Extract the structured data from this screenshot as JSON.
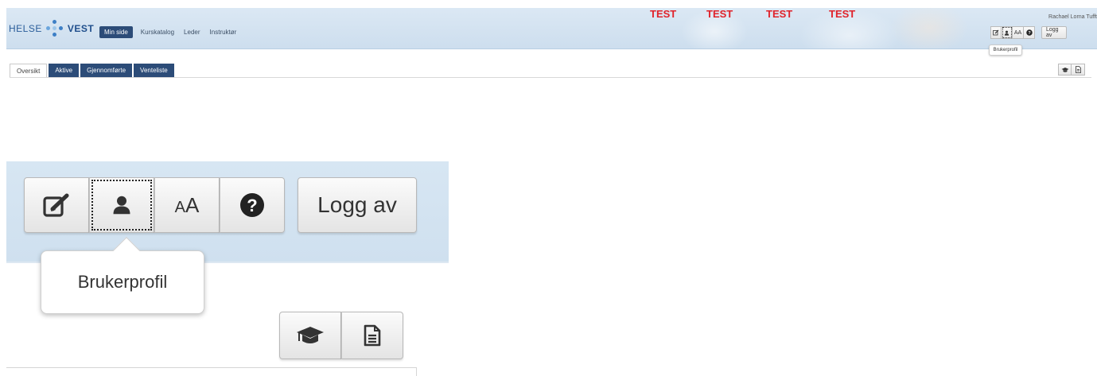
{
  "header": {
    "logo": {
      "left": "HELSE",
      "right": "VEST"
    },
    "nav": [
      {
        "label": "Min side",
        "active": true
      },
      {
        "label": "Kurskatalog",
        "active": false
      },
      {
        "label": "Leder",
        "active": false
      },
      {
        "label": "Instruktør",
        "active": false
      }
    ],
    "test_labels": [
      "TEST",
      "TEST",
      "TEST",
      "TEST"
    ],
    "user_name": "Rachael Lorna Tufft",
    "toolbar": {
      "edit_icon": "edit-icon",
      "profile_icon": "user-icon",
      "font_size_label": "AA",
      "help_icon": "question-icon",
      "logout_label": "Logg av"
    },
    "tooltip": "Brukerprofil"
  },
  "tabs": [
    {
      "label": "Oversikt",
      "active": true
    },
    {
      "label": "Aktive",
      "active": false
    },
    {
      "label": "Gjennomførte",
      "active": false
    },
    {
      "label": "Venteliste",
      "active": false
    }
  ],
  "right_toolbar": {
    "icons": [
      "graduation-cap-icon",
      "document-icon"
    ]
  },
  "zoom": {
    "font_size_label_small": "A",
    "font_size_label_large": "A",
    "logout_label": "Logg av",
    "tooltip": "Brukerprofil"
  },
  "colors": {
    "header_bg": "#d7e6f3",
    "nav_active": "#2c4c78",
    "test_red": "#e0222a",
    "logo_blue": "#2a5d9a"
  }
}
